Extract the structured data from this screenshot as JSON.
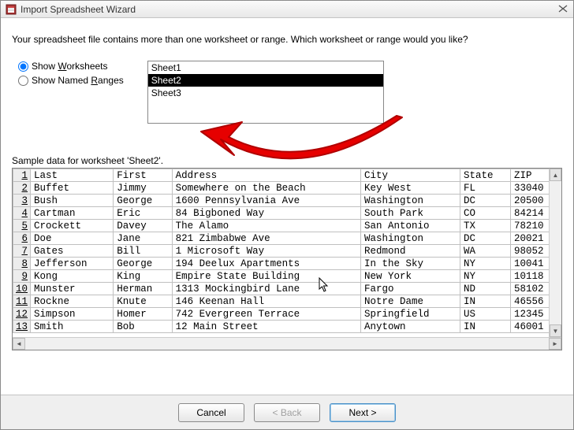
{
  "window": {
    "title": "Import Spreadsheet Wizard"
  },
  "intro": "Your spreadsheet file contains more than one worksheet or range. Which worksheet or range would you like?",
  "options": {
    "show_worksheets_label_pre": "Show ",
    "show_worksheets_label_u": "W",
    "show_worksheets_label_post": "orksheets",
    "show_named_ranges_label_pre": "Show Named ",
    "show_named_ranges_label_u": "R",
    "show_named_ranges_label_post": "anges"
  },
  "sheets": {
    "items": [
      "Sheet1",
      "Sheet2",
      "Sheet3"
    ],
    "selected": "Sheet2"
  },
  "sample_label": "Sample data for worksheet 'Sheet2'.",
  "table": {
    "headers": [
      "Last",
      "First",
      "Address",
      "City",
      "State",
      "ZIP"
    ],
    "rows": [
      [
        "Buffet",
        "Jimmy",
        "Somewhere on the Beach",
        "Key West",
        "FL",
        "33040"
      ],
      [
        "Bush",
        "George",
        "1600 Pennsylvania Ave",
        "Washington",
        "DC",
        "20500"
      ],
      [
        "Cartman",
        "Eric",
        "84 Bigboned Way",
        "South Park",
        "CO",
        "84214"
      ],
      [
        "Crockett",
        "Davey",
        "The Alamo",
        "San Antonio",
        "TX",
        "78210"
      ],
      [
        "Doe",
        "Jane",
        "821 Zimbabwe Ave",
        "Washington",
        "DC",
        "20021"
      ],
      [
        "Gates",
        "Bill",
        "1 Microsoft Way",
        "Redmond",
        "WA",
        "98052"
      ],
      [
        "Jefferson",
        "George",
        "194 Deelux Apartments",
        "In the Sky",
        "NY",
        "10041"
      ],
      [
        "Kong",
        "King",
        "Empire State Building",
        "New York",
        "NY",
        "10118"
      ],
      [
        "Munster",
        "Herman",
        "1313 Mockingbird Lane",
        "Fargo",
        "ND",
        "58102"
      ],
      [
        "Rockne",
        "Knute",
        "146 Keenan Hall",
        "Notre Dame",
        "IN",
        "46556"
      ],
      [
        "Simpson",
        "Homer",
        "742 Evergreen Terrace",
        "Springfield",
        "US",
        "12345"
      ],
      [
        "Smith",
        "Bob",
        "12 Main Street",
        "Anytown",
        "IN",
        "46001"
      ]
    ]
  },
  "buttons": {
    "cancel": "Cancel",
    "back": "< Back",
    "next": "Next >"
  }
}
